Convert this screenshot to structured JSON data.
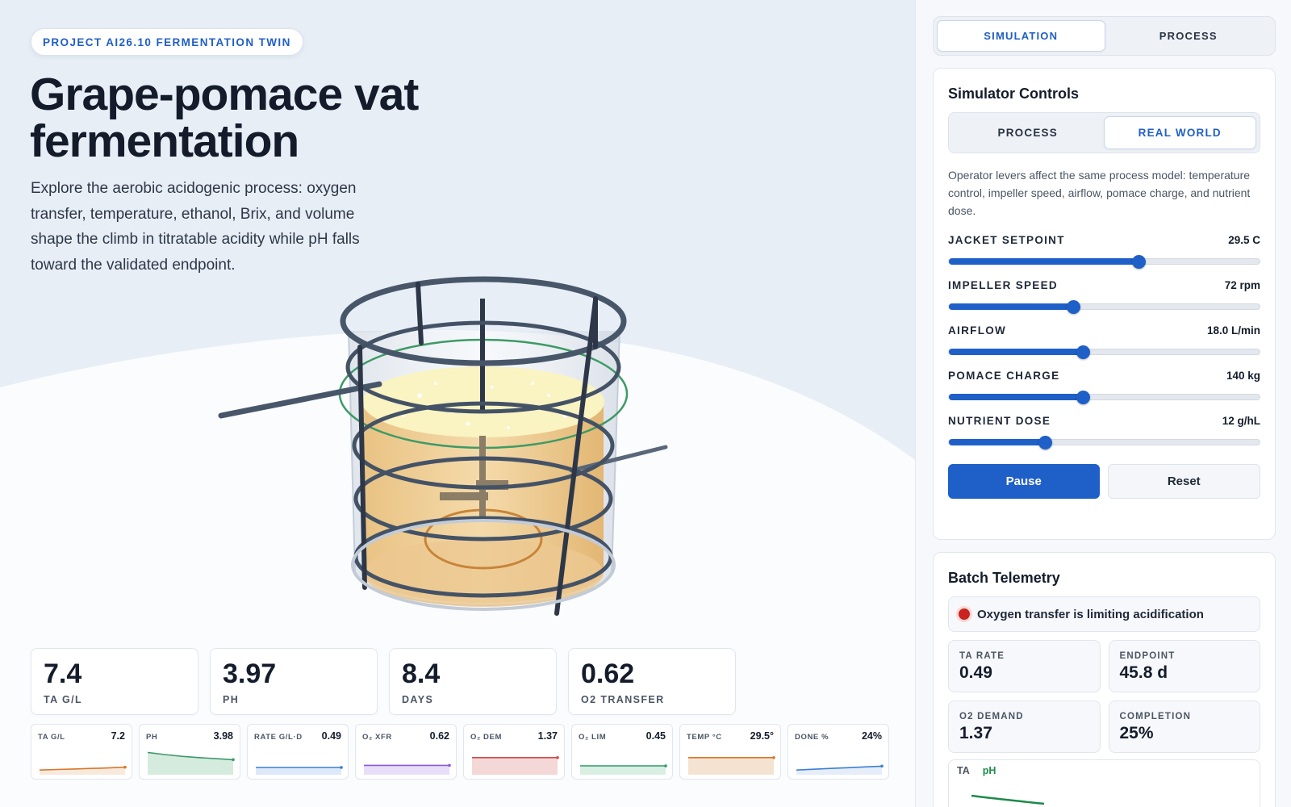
{
  "header": {
    "project_badge": "PROJECT AI26.10 FERMENTATION TWIN",
    "title": "Grape-pomace vat fermentation",
    "description": "Explore the aerobic acidogenic process: oxygen transfer, temperature, ethanol, Brix, and volume shape the climb in titratable acidity while pH falls toward the validated endpoint."
  },
  "metrics": [
    {
      "value": "7.4",
      "label": "TA G/L"
    },
    {
      "value": "3.97",
      "label": "PH"
    },
    {
      "value": "8.4",
      "label": "DAYS"
    },
    {
      "value": "0.62",
      "label": "O2 TRANSFER"
    }
  ],
  "sparks": [
    {
      "label": "TA G/L",
      "value": "7.2",
      "color": "#d9772b",
      "fill": "#f7e9dc",
      "trend": [
        0.12,
        0.14,
        0.16,
        0.18,
        0.2,
        0.23
      ]
    },
    {
      "label": "PH",
      "value": "3.98",
      "color": "#3c9a6a",
      "fill": "#d5ebde",
      "trend": [
        0.8,
        0.72,
        0.65,
        0.6,
        0.56,
        0.52
      ]
    },
    {
      "label": "RATE G/L·D",
      "value": "0.49",
      "color": "#3d7ed8",
      "fill": "#dde9f8",
      "trend": [
        0.22,
        0.22,
        0.22,
        0.22,
        0.22,
        0.22
      ]
    },
    {
      "label": "O₂ XFR",
      "value": "0.62",
      "color": "#8a5bd6",
      "fill": "#e8def8",
      "trend": [
        0.3,
        0.3,
        0.3,
        0.3,
        0.3,
        0.3
      ]
    },
    {
      "label": "O₂ DEM",
      "value": "1.37",
      "color": "#d24a4a",
      "fill": "#f4d7d7",
      "trend": [
        0.6,
        0.6,
        0.6,
        0.6,
        0.6,
        0.6
      ]
    },
    {
      "label": "O₂ LIM",
      "value": "0.45",
      "color": "#2f9b6b",
      "fill": "#d9efe3",
      "trend": [
        0.28,
        0.28,
        0.28,
        0.28,
        0.28,
        0.28
      ]
    },
    {
      "label": "TEMP °C",
      "value": "29.5°",
      "color": "#d9772b",
      "fill": "#f5e3d1",
      "trend": [
        0.6,
        0.6,
        0.6,
        0.6,
        0.6,
        0.6
      ]
    },
    {
      "label": "DONE %",
      "value": "24%",
      "color": "#3d7ed8",
      "fill": "#e5edf9",
      "trend": [
        0.12,
        0.15,
        0.18,
        0.21,
        0.24,
        0.27
      ]
    }
  ],
  "panel": {
    "tabs": [
      {
        "label": "SIMULATION",
        "active": true
      },
      {
        "label": "PROCESS",
        "active": false
      }
    ],
    "controls_title": "Simulator Controls",
    "mode_tabs": [
      {
        "label": "PROCESS",
        "active": false
      },
      {
        "label": "REAL WORLD",
        "active": true
      }
    ],
    "controls_desc": "Operator levers affect the same process model: temperature control, impeller speed, airflow, pomace charge, and nutrient dose.",
    "sliders": [
      {
        "label": "JACKET SETPOINT",
        "value": "29.5 C",
        "fraction": 0.61
      },
      {
        "label": "IMPELLER SPEED",
        "value": "72 rpm",
        "fraction": 0.4
      },
      {
        "label": "AIRFLOW",
        "value": "18.0 L/min",
        "fraction": 0.43
      },
      {
        "label": "POMACE CHARGE",
        "value": "140 kg",
        "fraction": 0.43
      },
      {
        "label": "NUTRIENT DOSE",
        "value": "12 g/hL",
        "fraction": 0.31
      }
    ],
    "pause_label": "Pause",
    "reset_label": "Reset",
    "telemetry_title": "Batch Telemetry",
    "status_text": "Oxygen transfer is limiting acidification",
    "tiles": [
      {
        "label": "TA RATE",
        "value": "0.49"
      },
      {
        "label": "ENDPOINT",
        "value": "45.8 d"
      },
      {
        "label": "O2 DEMAND",
        "value": "1.37"
      },
      {
        "label": "COMPLETION",
        "value": "25%"
      }
    ],
    "chart_legend": {
      "ta": "TA",
      "ph": "pH"
    }
  }
}
